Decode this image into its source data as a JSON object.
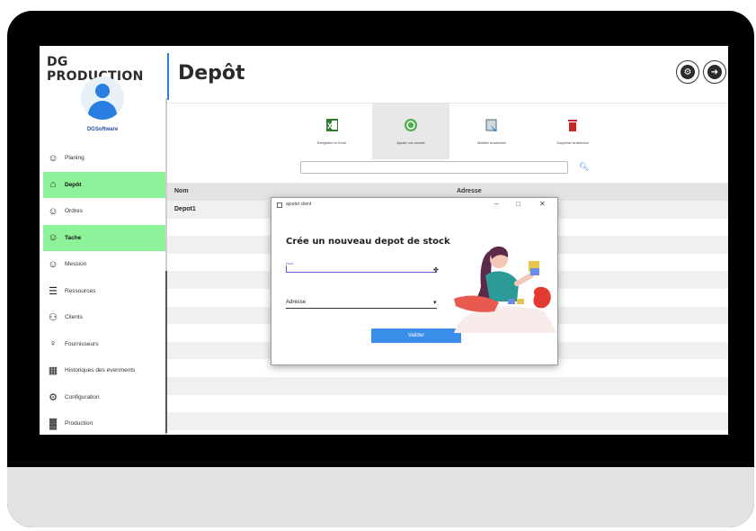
{
  "sidebar": {
    "brand": "DG PRODUCTION",
    "company": "DGSoftware",
    "items": [
      {
        "label": "Planing",
        "icon": "person-icon",
        "active": false
      },
      {
        "label": "Depôt",
        "icon": "warehouse-icon",
        "active": true
      },
      {
        "label": "Ordres",
        "icon": "person-icon",
        "active": false
      },
      {
        "label": "Tache",
        "icon": "person-icon",
        "active": true
      },
      {
        "label": "Mession",
        "icon": "person-icon",
        "active": false
      },
      {
        "label": "Ressources",
        "icon": "list-icon",
        "active": false
      },
      {
        "label": "Clients",
        "icon": "group-icon",
        "active": false
      },
      {
        "label": "Fournisseurs",
        "icon": "person-outline-icon",
        "active": false
      },
      {
        "label": "Historiques des evenments",
        "icon": "calendar-icon",
        "active": false
      },
      {
        "label": "Configuration",
        "icon": "gear-icon",
        "active": false
      },
      {
        "label": "Production",
        "icon": "factory-icon",
        "active": false
      }
    ]
  },
  "header": {
    "title": "Depôt"
  },
  "toolbar": {
    "buttons": [
      {
        "label": "Enregistrer en Excel",
        "icon": "excel-icon"
      },
      {
        "label": "Ajouter une donnée",
        "icon": "add-icon"
      },
      {
        "label": "Modifier la selection",
        "icon": "edit-icon"
      },
      {
        "label": "Supprimer la selection",
        "icon": "trash-icon"
      }
    ]
  },
  "search": {
    "value": ""
  },
  "table": {
    "columns": [
      "Nom",
      "Adresse"
    ],
    "rows": [
      [
        "Depot1",
        ""
      ]
    ]
  },
  "dialog": {
    "title": "ajouter client",
    "heading": "Crée un nouveau depot de stock",
    "nom_label": "Nom",
    "adresse_label": "Adresse",
    "submit": "Valider"
  },
  "colors": {
    "accent": "#2a7de1",
    "active_nav": "#8ef29a",
    "button": "#3a8de8"
  }
}
